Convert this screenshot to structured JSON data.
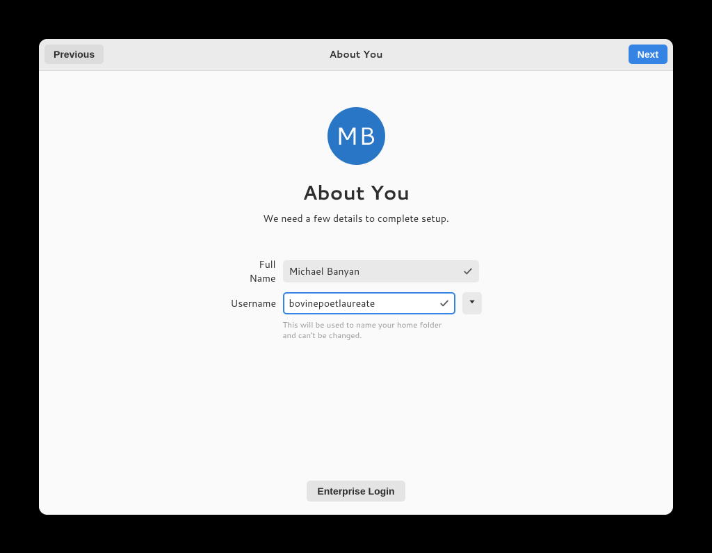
{
  "header": {
    "title": "About You",
    "previous_label": "Previous",
    "next_label": "Next"
  },
  "avatar": {
    "initials": "MB"
  },
  "page": {
    "title": "About You",
    "subtitle": "We need a few details to complete setup."
  },
  "form": {
    "fullname_label": "Full Name",
    "fullname_value": "Michael Banyan",
    "username_label": "Username",
    "username_value": "bovinepoetlaureate",
    "username_help": "This will be used to name your home folder and can't be changed."
  },
  "footer": {
    "enterprise_label": "Enterprise Login"
  },
  "colors": {
    "accent": "#3584e4",
    "avatar_bg": "#2a76c6"
  }
}
